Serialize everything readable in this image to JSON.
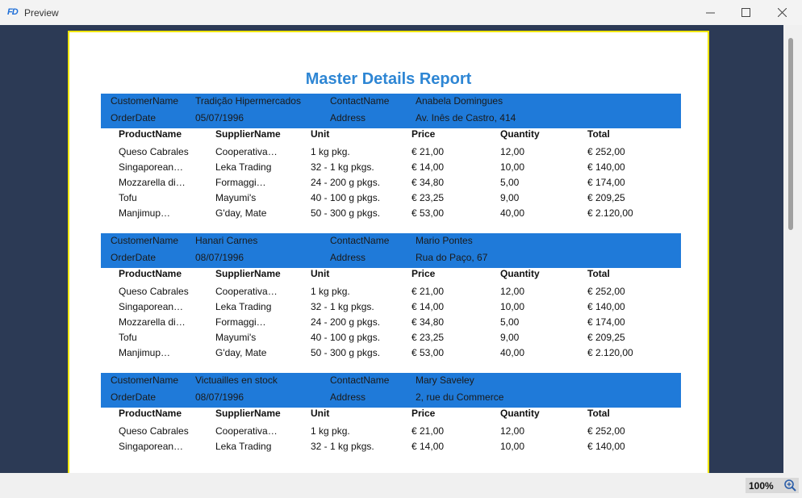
{
  "window": {
    "logo": "FD",
    "title": "Preview"
  },
  "report": {
    "title": "Master Details Report",
    "labels": {
      "customer": "CustomerName",
      "contact": "ContactName",
      "order_date": "OrderDate",
      "address": "Address"
    },
    "columns": [
      "ProductName",
      "SupplierName",
      "Unit",
      "Price",
      "Quantity",
      "Total"
    ],
    "groups": [
      {
        "customer": "Tradição Hipermercados",
        "contact": "Anabela Domingues",
        "order_date": "05/07/1996",
        "address": "Av. Inês de Castro, 414",
        "rows": [
          [
            "Queso Cabrales",
            "Cooperativa…",
            "1 kg pkg.",
            "€ 21,00",
            "12,00",
            "€ 252,00"
          ],
          [
            "Singaporean…",
            "Leka Trading",
            "32 - 1 kg pkgs.",
            "€ 14,00",
            "10,00",
            "€ 140,00"
          ],
          [
            "Mozzarella di…",
            "Formaggi…",
            "24 - 200 g pkgs.",
            "€ 34,80",
            "5,00",
            "€ 174,00"
          ],
          [
            "Tofu",
            "Mayumi's",
            "40 - 100 g pkgs.",
            "€ 23,25",
            "9,00",
            "€ 209,25"
          ],
          [
            "Manjimup…",
            "G'day, Mate",
            "50 - 300 g pkgs.",
            "€ 53,00",
            "40,00",
            "€ 2.120,00"
          ]
        ]
      },
      {
        "customer": "Hanari Carnes",
        "contact": "Mario Pontes",
        "order_date": "08/07/1996",
        "address": "Rua do Paço, 67",
        "rows": [
          [
            "Queso Cabrales",
            "Cooperativa…",
            "1 kg pkg.",
            "€ 21,00",
            "12,00",
            "€ 252,00"
          ],
          [
            "Singaporean…",
            "Leka Trading",
            "32 - 1 kg pkgs.",
            "€ 14,00",
            "10,00",
            "€ 140,00"
          ],
          [
            "Mozzarella di…",
            "Formaggi…",
            "24 - 200 g pkgs.",
            "€ 34,80",
            "5,00",
            "€ 174,00"
          ],
          [
            "Tofu",
            "Mayumi's",
            "40 - 100 g pkgs.",
            "€ 23,25",
            "9,00",
            "€ 209,25"
          ],
          [
            "Manjimup…",
            "G'day, Mate",
            "50 - 300 g pkgs.",
            "€ 53,00",
            "40,00",
            "€ 2.120,00"
          ]
        ]
      },
      {
        "customer": "Victuailles en stock",
        "contact": "Mary Saveley",
        "order_date": "08/07/1996",
        "address": "2, rue du Commerce",
        "rows": [
          [
            "Queso Cabrales",
            "Cooperativa…",
            "1 kg pkg.",
            "€ 21,00",
            "12,00",
            "€ 252,00"
          ],
          [
            "Singaporean…",
            "Leka Trading",
            "32 - 1 kg pkgs.",
            "€ 14,00",
            "10,00",
            "€ 140,00"
          ]
        ]
      }
    ]
  },
  "status": {
    "zoom": "100%"
  },
  "icons": {
    "minimize": "minimize-icon",
    "maximize": "maximize-icon",
    "close": "close-icon",
    "zoom": "zoom-in-icon"
  },
  "colors": {
    "band": "#1f7ad9",
    "title": "#2e86d4",
    "page_border": "#f0e600",
    "viewer_bg": "#2c3a55"
  }
}
